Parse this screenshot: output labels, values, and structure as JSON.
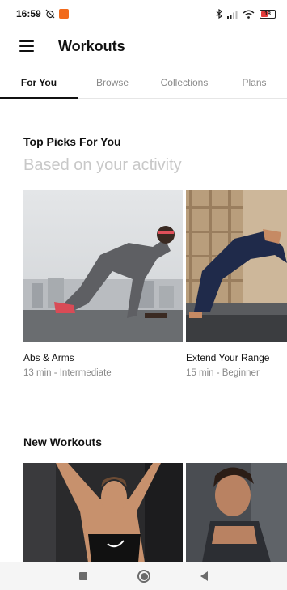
{
  "status_bar": {
    "time": "16:59",
    "battery_level": "18"
  },
  "app_bar": {
    "title": "Workouts"
  },
  "tabs": [
    {
      "label": "For You",
      "active": true
    },
    {
      "label": "Browse",
      "active": false
    },
    {
      "label": "Collections",
      "active": false
    },
    {
      "label": "Plans",
      "active": false
    }
  ],
  "top_picks": {
    "title": "Top Picks For You",
    "subtitle": "Based on your activity",
    "cards": [
      {
        "name": "Abs & Arms",
        "meta": "13 min - Intermediate"
      },
      {
        "name": "Extend Your Range",
        "meta": "15 min - Beginner"
      }
    ]
  },
  "new_workouts": {
    "title": "New Workouts"
  },
  "colors": {
    "accent": "#111111",
    "muted_text": "#8a8a8a",
    "subtitle_text": "#c8c8c8",
    "notification_badge": "#f26a1b",
    "battery_low": "#e23b3b"
  }
}
